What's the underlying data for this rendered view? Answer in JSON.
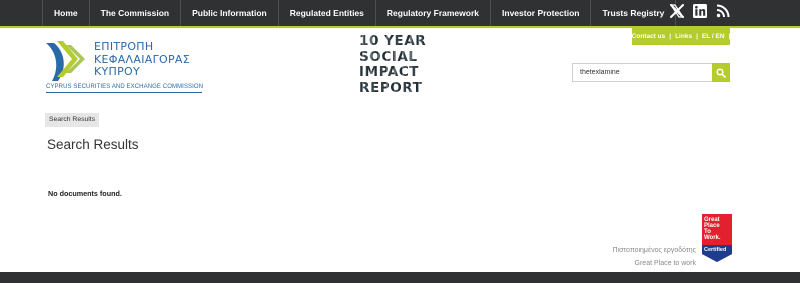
{
  "nav": {
    "items": [
      {
        "label": "Home"
      },
      {
        "label": "The Commission"
      },
      {
        "label": "Public Information"
      },
      {
        "label": "Regulated Entities"
      },
      {
        "label": "Regulatory Framework"
      },
      {
        "label": "Investor Protection"
      },
      {
        "label": "Trusts Registry"
      }
    ],
    "social": [
      "x-icon",
      "linkedin-icon",
      "rss-icon"
    ]
  },
  "utility": {
    "contact": "Contact us",
    "links": "Links",
    "lang": "EL / EN",
    "sep": "|"
  },
  "logo": {
    "greek_line1": "ΕΠΙΤΡΟΠΗ",
    "greek_line2": "ΚΕΦΑΛΑΙΑΓΟΡΑΣ",
    "greek_line3": "ΚΥΠΡΟΥ",
    "english": "CYPRUS SECURITIES AND EXCHANGE COMMISSION"
  },
  "banner": {
    "line1": "10 YEAR",
    "line2": "SOCIAL",
    "line3": "IMPACT",
    "line4": "REPORT"
  },
  "search": {
    "value": "thetexlamine"
  },
  "breadcrumb": "Search Results",
  "page_title": "Search Results",
  "message": "No documents found.",
  "gptw": {
    "line1": "Πιστοποιημένος εργοδότης",
    "line2": "Great Place to work",
    "badge_line1": "Great",
    "badge_line2": "Place",
    "badge_line3": "To",
    "badge_line4": "Work.",
    "badge_line5": "Certified"
  },
  "colors": {
    "accent": "#b5cc2e",
    "nav_bg": "#2f3133",
    "brand_blue": "#2a6aa8",
    "badge_red": "#e3202e"
  }
}
